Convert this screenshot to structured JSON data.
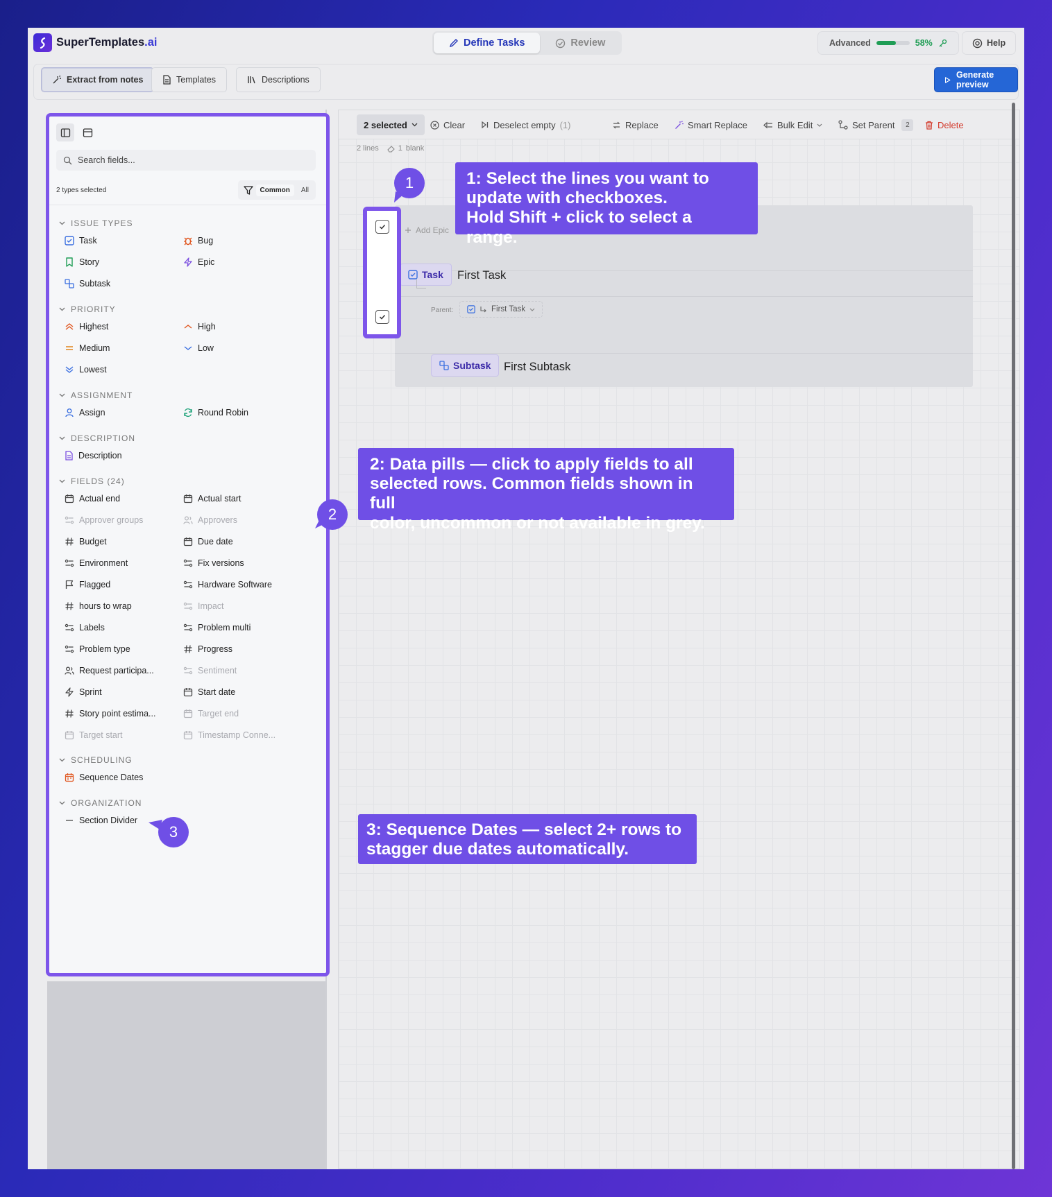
{
  "app": {
    "brand": "SuperTemplates",
    "brand_suffix": ".ai"
  },
  "topbar": {
    "tabs": [
      {
        "label": "Define Tasks",
        "active": true
      },
      {
        "label": "Review",
        "active": false
      }
    ],
    "progress": {
      "label": "Advanced",
      "value": 58,
      "value_text": "58%"
    },
    "help_label": "Help"
  },
  "subbar": {
    "buttons": [
      {
        "label": "Extract from notes",
        "icon": "magic-wand-icon",
        "active": true
      },
      {
        "label": "Templates",
        "icon": "document-icon",
        "active": false
      },
      {
        "label": "Descriptions",
        "icon": "library-icon",
        "active": false
      }
    ],
    "generate_label": "Generate preview"
  },
  "panel": {
    "search_placeholder": "Search fields...",
    "types_selected": "2 types selected",
    "filter_options": [
      "Common",
      "All"
    ],
    "sections": {
      "issue_types": "ISSUE TYPES",
      "priority": "PRIORITY",
      "assignment": "ASSIGNMENT",
      "description": "DESCRIPTION",
      "fields": "FIELDS (24)",
      "scheduling": "SCHEDULING",
      "organization": "ORGANIZATION"
    },
    "issue_types": [
      "Task",
      "Bug",
      "Story",
      "Epic",
      "Subtask"
    ],
    "priority": [
      "Highest",
      "High",
      "Medium",
      "Low",
      "Lowest"
    ],
    "assignment": [
      "Assign",
      "Round Robin"
    ],
    "description": [
      "Description"
    ],
    "fields": [
      {
        "label": "Actual end",
        "icon": "calendar-icon",
        "common": true
      },
      {
        "label": "Actual start",
        "icon": "calendar-icon",
        "common": true
      },
      {
        "label": "Approver groups",
        "icon": "select-icon",
        "common": false
      },
      {
        "label": "Approvers",
        "icon": "users-icon",
        "common": false
      },
      {
        "label": "Budget",
        "icon": "hash-icon",
        "common": true
      },
      {
        "label": "Due date",
        "icon": "calendar-icon",
        "common": true
      },
      {
        "label": "Environment",
        "icon": "select-icon",
        "common": true
      },
      {
        "label": "Fix versions",
        "icon": "select-icon",
        "common": true
      },
      {
        "label": "Flagged",
        "icon": "flag-icon",
        "common": true
      },
      {
        "label": "Hardware Software",
        "icon": "select-icon",
        "common": true
      },
      {
        "label": "hours to wrap",
        "icon": "hash-icon",
        "common": true
      },
      {
        "label": "Impact",
        "icon": "select-icon",
        "common": false
      },
      {
        "label": "Labels",
        "icon": "select-icon",
        "common": true
      },
      {
        "label": "Problem multi",
        "icon": "select-icon",
        "common": true
      },
      {
        "label": "Problem type",
        "icon": "select-icon",
        "common": true
      },
      {
        "label": "Progress",
        "icon": "hash-icon",
        "common": true
      },
      {
        "label": "Request participa...",
        "icon": "users-icon",
        "common": true
      },
      {
        "label": "Sentiment",
        "icon": "select-icon",
        "common": false
      },
      {
        "label": "Sprint",
        "icon": "sprint-icon",
        "common": true
      },
      {
        "label": "Start date",
        "icon": "calendar-icon",
        "common": true
      },
      {
        "label": "Story point estima...",
        "icon": "hash-icon",
        "common": true
      },
      {
        "label": "Target end",
        "icon": "calendar-icon",
        "common": false
      },
      {
        "label": "Target start",
        "icon": "calendar-icon",
        "common": false
      },
      {
        "label": "Timestamp Conne...",
        "icon": "calendar-icon",
        "common": false
      }
    ],
    "scheduling": [
      "Sequence Dates"
    ],
    "organization": [
      "Section Divider"
    ]
  },
  "toolbar": {
    "selected_label": "2 selected",
    "clear_label": "Clear",
    "deselect_label": "Deselect empty",
    "deselect_count": "(1)",
    "replace_label": "Replace",
    "smart_replace_label": "Smart Replace",
    "bulk_edit_label": "Bulk Edit",
    "set_parent_label": "Set Parent",
    "set_parent_count": "2",
    "delete_label": "Delete"
  },
  "meta": {
    "lines": "2 lines",
    "blank_count": "1",
    "blank_label": "blank"
  },
  "editor": {
    "add_epic": "Add Epic",
    "rows": [
      {
        "type": "Task",
        "title": "First Task",
        "checked": true
      },
      {
        "type": "Subtask",
        "title": "First Subtask",
        "checked": true
      }
    ],
    "parent_label": "Parent:",
    "parent_value": "First Task"
  },
  "callouts": {
    "c1": {
      "number": "1",
      "lines": [
        "1: Select the lines you want to",
        "update with checkboxes.",
        "Hold Shift + click to select a range."
      ]
    },
    "c2": {
      "number": "2",
      "lines": [
        "2: Data pills — click to apply fields to all",
        "selected rows. Common fields shown in full",
        "color, uncommon or not available in grey."
      ]
    },
    "c3": {
      "number": "3",
      "lines": [
        "3:  Sequence Dates — select 2+ rows to",
        "stagger due dates automatically."
      ]
    }
  },
  "colors": {
    "accent": "#7d55ea",
    "callout": "#6f4fe6",
    "primary": "#2566d6",
    "danger": "#d33a2c",
    "success": "#1f9d55"
  }
}
